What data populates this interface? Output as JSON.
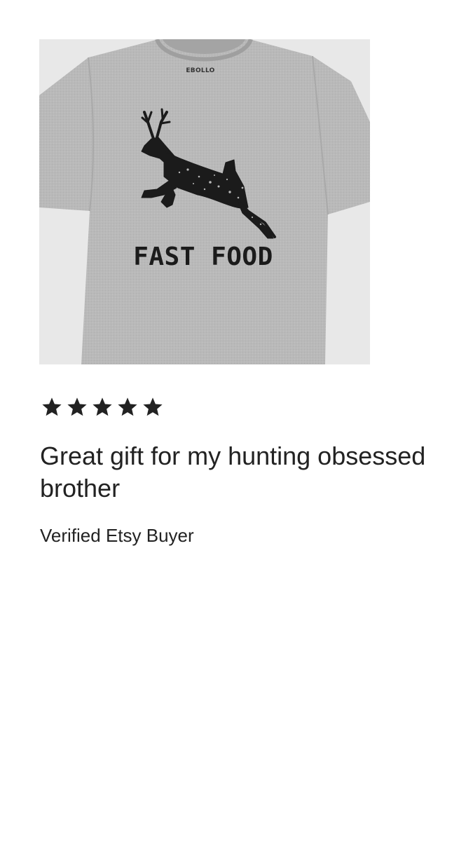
{
  "product": {
    "brand_label": "EBOLLO",
    "shirt_text": "FAST FOOD",
    "image_icon": "deer-tshirt-image",
    "shirt_color": "#b9b9b9",
    "print_color": "#1b1b1b"
  },
  "review": {
    "rating": 5,
    "rating_max": 5,
    "star_color": "#222222",
    "title": "Great gift for my hunting obsessed brother",
    "reviewer": "Verified Etsy Buyer"
  }
}
